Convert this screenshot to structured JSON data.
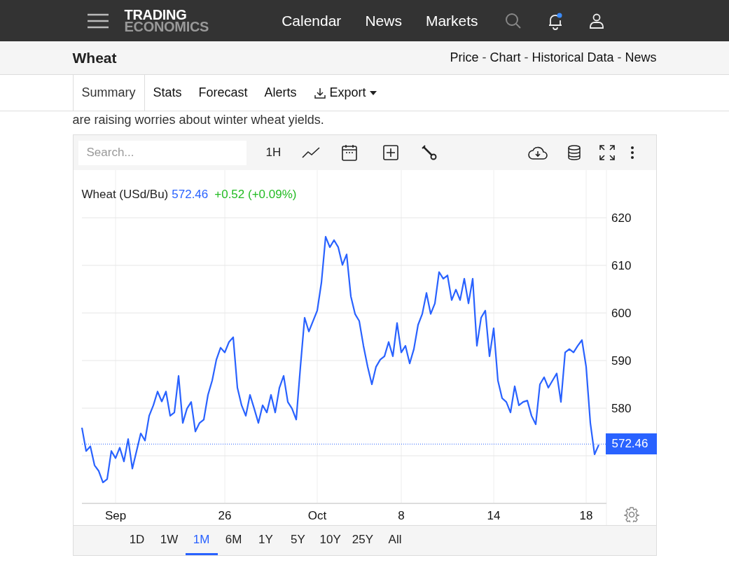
{
  "header": {
    "logo": [
      "TRADING",
      "ECONOMICS"
    ],
    "nav": [
      "Calendar",
      "News",
      "Markets"
    ]
  },
  "page": {
    "title": "Wheat",
    "links": [
      {
        "kind": "link",
        "label": "Price"
      },
      {
        "kind": "separator",
        "label": "-"
      },
      {
        "kind": "link",
        "label": "Chart"
      },
      {
        "kind": "separator",
        "label": "-"
      },
      {
        "kind": "link",
        "label": "Historical Data"
      },
      {
        "kind": "separator",
        "label": "-"
      },
      {
        "kind": "link",
        "label": "News"
      }
    ]
  },
  "tabs": [
    {
      "label": "Summary",
      "selected": true,
      "kind": "tab"
    },
    {
      "label": "Stats",
      "selected": false,
      "kind": "tab"
    },
    {
      "label": "Forecast",
      "selected": false,
      "kind": "tab"
    },
    {
      "label": "Alerts",
      "selected": false,
      "kind": "tab"
    },
    {
      "label": "Export",
      "selected": false,
      "kind": "dropdown"
    }
  ],
  "article_text": "are raising worries about winter wheat yields.",
  "chart": {
    "search": {
      "placeholder": "Search..."
    },
    "interval": "1H",
    "legend": {
      "price": "572.46",
      "change": "+0.52 (+0.09%)"
    },
    "last_price": "572.46",
    "chart_data": {
      "type": "line",
      "categories": [
        null,
        null,
        null,
        null,
        null,
        null,
        null,
        null,
        "Sep",
        null,
        null,
        null,
        null,
        null,
        null,
        null,
        null,
        null,
        null,
        null,
        null,
        null,
        null,
        null,
        null,
        null,
        null,
        null,
        null,
        null,
        null,
        null,
        null,
        null,
        "26",
        null,
        null,
        null,
        null,
        null,
        null,
        null,
        null,
        null,
        null,
        null,
        null,
        null,
        null,
        null,
        null,
        null,
        null,
        null,
        null,
        null,
        "Oct",
        null,
        null,
        null,
        null,
        null,
        null,
        null,
        null,
        null,
        null,
        null,
        null,
        null,
        null,
        null,
        null,
        null,
        null,
        null,
        "8",
        null,
        null,
        null,
        null,
        null,
        null,
        null,
        null,
        null,
        null,
        null,
        null,
        null,
        null,
        null,
        null,
        null,
        null,
        null,
        null,
        null,
        "14",
        null,
        null,
        null,
        null,
        null,
        null,
        null,
        null,
        null,
        null,
        null,
        null,
        null,
        null,
        null,
        null,
        null,
        null,
        null,
        null,
        null,
        "18",
        null,
        null,
        null
      ],
      "series": [
        {
          "name": "Wheat (USd/Bu)",
          "color": "#2962ff",
          "values": [
            575.9,
            571.0,
            572.0,
            568.0,
            566.8,
            564.4,
            565.1,
            571.0,
            569.5,
            571.7,
            568.8,
            573.5,
            567.3,
            571.0,
            574.7,
            573.2,
            578.4,
            580.6,
            583.5,
            581.4,
            583.5,
            578.4,
            579.1,
            586.8,
            576.9,
            579.9,
            581.3,
            575.1,
            576.9,
            577.6,
            582.8,
            585.8,
            590.2,
            592.7,
            591.7,
            593.9,
            594.9,
            584.3,
            580.6,
            578.4,
            582.8,
            579.9,
            576.9,
            580.6,
            579.1,
            582.8,
            579.1,
            584.3,
            586.8,
            581.3,
            579.9,
            577.6,
            588.7,
            599.0,
            596.1,
            598.3,
            600.5,
            606.4,
            616.0,
            613.8,
            615.3,
            613.8,
            610.1,
            612.3,
            603.5,
            599.8,
            598.3,
            593.1,
            588.7,
            585.0,
            588.7,
            590.2,
            590.9,
            593.9,
            590.9,
            597.9,
            591.7,
            593.1,
            589.4,
            592.4,
            597.5,
            599.8,
            604.2,
            599.8,
            602.0,
            608.6,
            607.2,
            607.9,
            602.7,
            604.9,
            602.7,
            607.2,
            602.0,
            607.2,
            593.1,
            599.0,
            600.5,
            590.9,
            596.8,
            585.8,
            582.1,
            581.3,
            579.1,
            584.6,
            580.6,
            581.3,
            581.6,
            578.4,
            576.6,
            585.0,
            586.5,
            584.3,
            585.8,
            587.3,
            581.3,
            591.7,
            592.4,
            591.7,
            593.1,
            594.3,
            588.7,
            576.9,
            570.3,
            572.3
          ]
        }
      ],
      "ylim": [
        560,
        630
      ],
      "grid": true,
      "ref_lines": [
        {
          "axis": "y",
          "value": 572.46,
          "color": "#2962ff"
        }
      ],
      "yticks": [
        580,
        590,
        600,
        610,
        620
      ]
    },
    "ranges": [
      {
        "label": "1D",
        "selected": false
      },
      {
        "label": "1W",
        "selected": false
      },
      {
        "label": "1M",
        "selected": true
      },
      {
        "label": "6M",
        "selected": false
      },
      {
        "label": "1Y",
        "selected": false
      },
      {
        "label": "5Y",
        "selected": false
      },
      {
        "label": "10Y",
        "selected": false
      },
      {
        "label": "25Y",
        "selected": false
      },
      {
        "label": "All",
        "selected": false
      }
    ]
  }
}
